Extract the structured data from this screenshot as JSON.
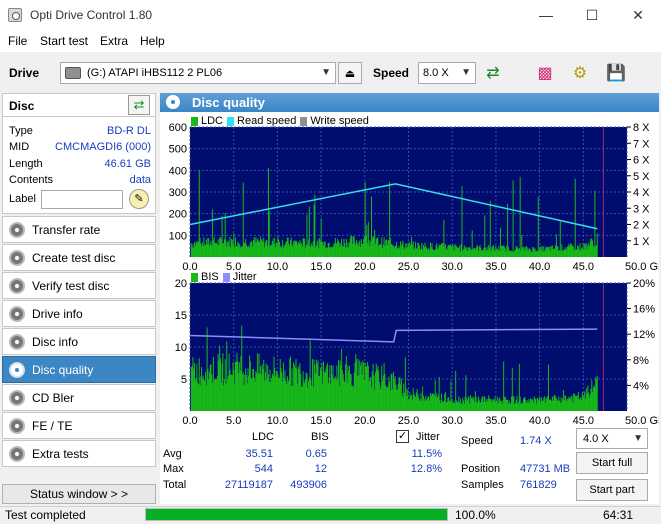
{
  "window": {
    "title": "Opti Drive Control 1.80"
  },
  "menu": [
    "File",
    "Start test",
    "Extra",
    "Help"
  ],
  "toolbar": {
    "drive_label": "Drive",
    "drive_value": "(G:)   ATAPI iHBS112   2 PL06",
    "speed_label": "Speed",
    "speed_value": "8.0 X"
  },
  "disc": {
    "header": "Disc",
    "type_key": "Type",
    "type_val": "BD-R DL",
    "mid_key": "MID",
    "mid_val": "CMCMAGDI6 (000)",
    "length_key": "Length",
    "length_val": "46.61 GB",
    "contents_key": "Contents",
    "contents_val": "data",
    "label_key": "Label"
  },
  "sidebar": [
    {
      "label": "Transfer rate"
    },
    {
      "label": "Create test disc"
    },
    {
      "label": "Verify test disc"
    },
    {
      "label": "Drive info"
    },
    {
      "label": "Disc info"
    },
    {
      "label": "Disc quality"
    },
    {
      "label": "CD Bler"
    },
    {
      "label": "FE / TE"
    },
    {
      "label": "Extra tests"
    }
  ],
  "status_window_btn": "Status window > >",
  "main": {
    "title": "Disc quality"
  },
  "chart_data": [
    {
      "type": "area",
      "legend": [
        "LDC",
        "Read speed",
        "Write speed"
      ],
      "colors": {
        "LDC": "#18b818",
        "Read speed": "#33dfee",
        "Write speed": "#909090"
      },
      "x_ticks": [
        "0.0",
        "5.0",
        "10.0",
        "15.0",
        "20.0",
        "25.0",
        "30.0",
        "35.0",
        "40.0",
        "45.0",
        "50.0 GB"
      ],
      "y_left_ticks": [
        "600",
        "500",
        "400",
        "300",
        "200",
        "100"
      ],
      "y_right_ticks": [
        "8 X",
        "7 X",
        "6 X",
        "5 X",
        "4 X",
        "3 X",
        "2 X",
        "1 X"
      ],
      "xlim": [
        0,
        50
      ],
      "ylim": [
        0,
        600
      ],
      "read_speed": {
        "x": [
          0,
          23.5,
          46.61
        ],
        "y": [
          2,
          4.5,
          1.74
        ]
      },
      "ldc_profile": {
        "x": [
          0,
          5,
          10,
          15,
          20,
          25,
          30,
          35,
          40,
          45,
          46.61
        ],
        "y": [
          70,
          80,
          75,
          70,
          85,
          60,
          50,
          45,
          40,
          55,
          90
        ]
      }
    },
    {
      "type": "area",
      "legend": [
        "BIS",
        "Jitter"
      ],
      "colors": {
        "BIS": "#18b818",
        "Jitter": "#8c8cff"
      },
      "x_ticks": [
        "0.0",
        "5.0",
        "10.0",
        "15.0",
        "20.0",
        "25.0",
        "30.0",
        "35.0",
        "40.0",
        "45.0",
        "50.0 GB"
      ],
      "y_left_ticks": [
        "20",
        "15",
        "10",
        "5"
      ],
      "y_right_ticks": [
        "20%",
        "16%",
        "12%",
        "8%",
        "4%"
      ],
      "xlim": [
        0,
        50
      ],
      "ylim": [
        0,
        20
      ],
      "jitter": {
        "x": [
          0,
          23.3,
          23.6,
          46.61
        ],
        "y": [
          11.8,
          10.8,
          12.6,
          12.8
        ]
      },
      "bis_profile": {
        "x": [
          0,
          5,
          10,
          15,
          20,
          23.5,
          25,
          30,
          35,
          40,
          45,
          46.61
        ],
        "y": [
          7,
          7.5,
          7,
          6.5,
          6.5,
          5,
          3,
          2,
          2,
          1.8,
          2.5,
          5
        ]
      }
    }
  ],
  "stats": {
    "col_ldc": "LDC",
    "col_bis": "BIS",
    "jitter_label": "Jitter",
    "avg_label": "Avg",
    "max_label": "Max",
    "total_label": "Total",
    "ldc_avg": "35.51",
    "bis_avg": "0.65",
    "jit_avg": "11.5%",
    "ldc_max": "544",
    "bis_max": "12",
    "jit_max": "12.8%",
    "ldc_total": "27119187",
    "bis_total": "493906",
    "speed_label": "Speed",
    "speed_val": "1.74 X",
    "position_label": "Position",
    "position_val": "47731 MB",
    "samples_label": "Samples",
    "samples_val": "761829",
    "speed_combo": "4.0 X",
    "start_full": "Start full",
    "start_part": "Start part"
  },
  "status": {
    "text": "Test completed",
    "progress": 1.0,
    "progress_text": "100.0%",
    "time": "64:31"
  }
}
